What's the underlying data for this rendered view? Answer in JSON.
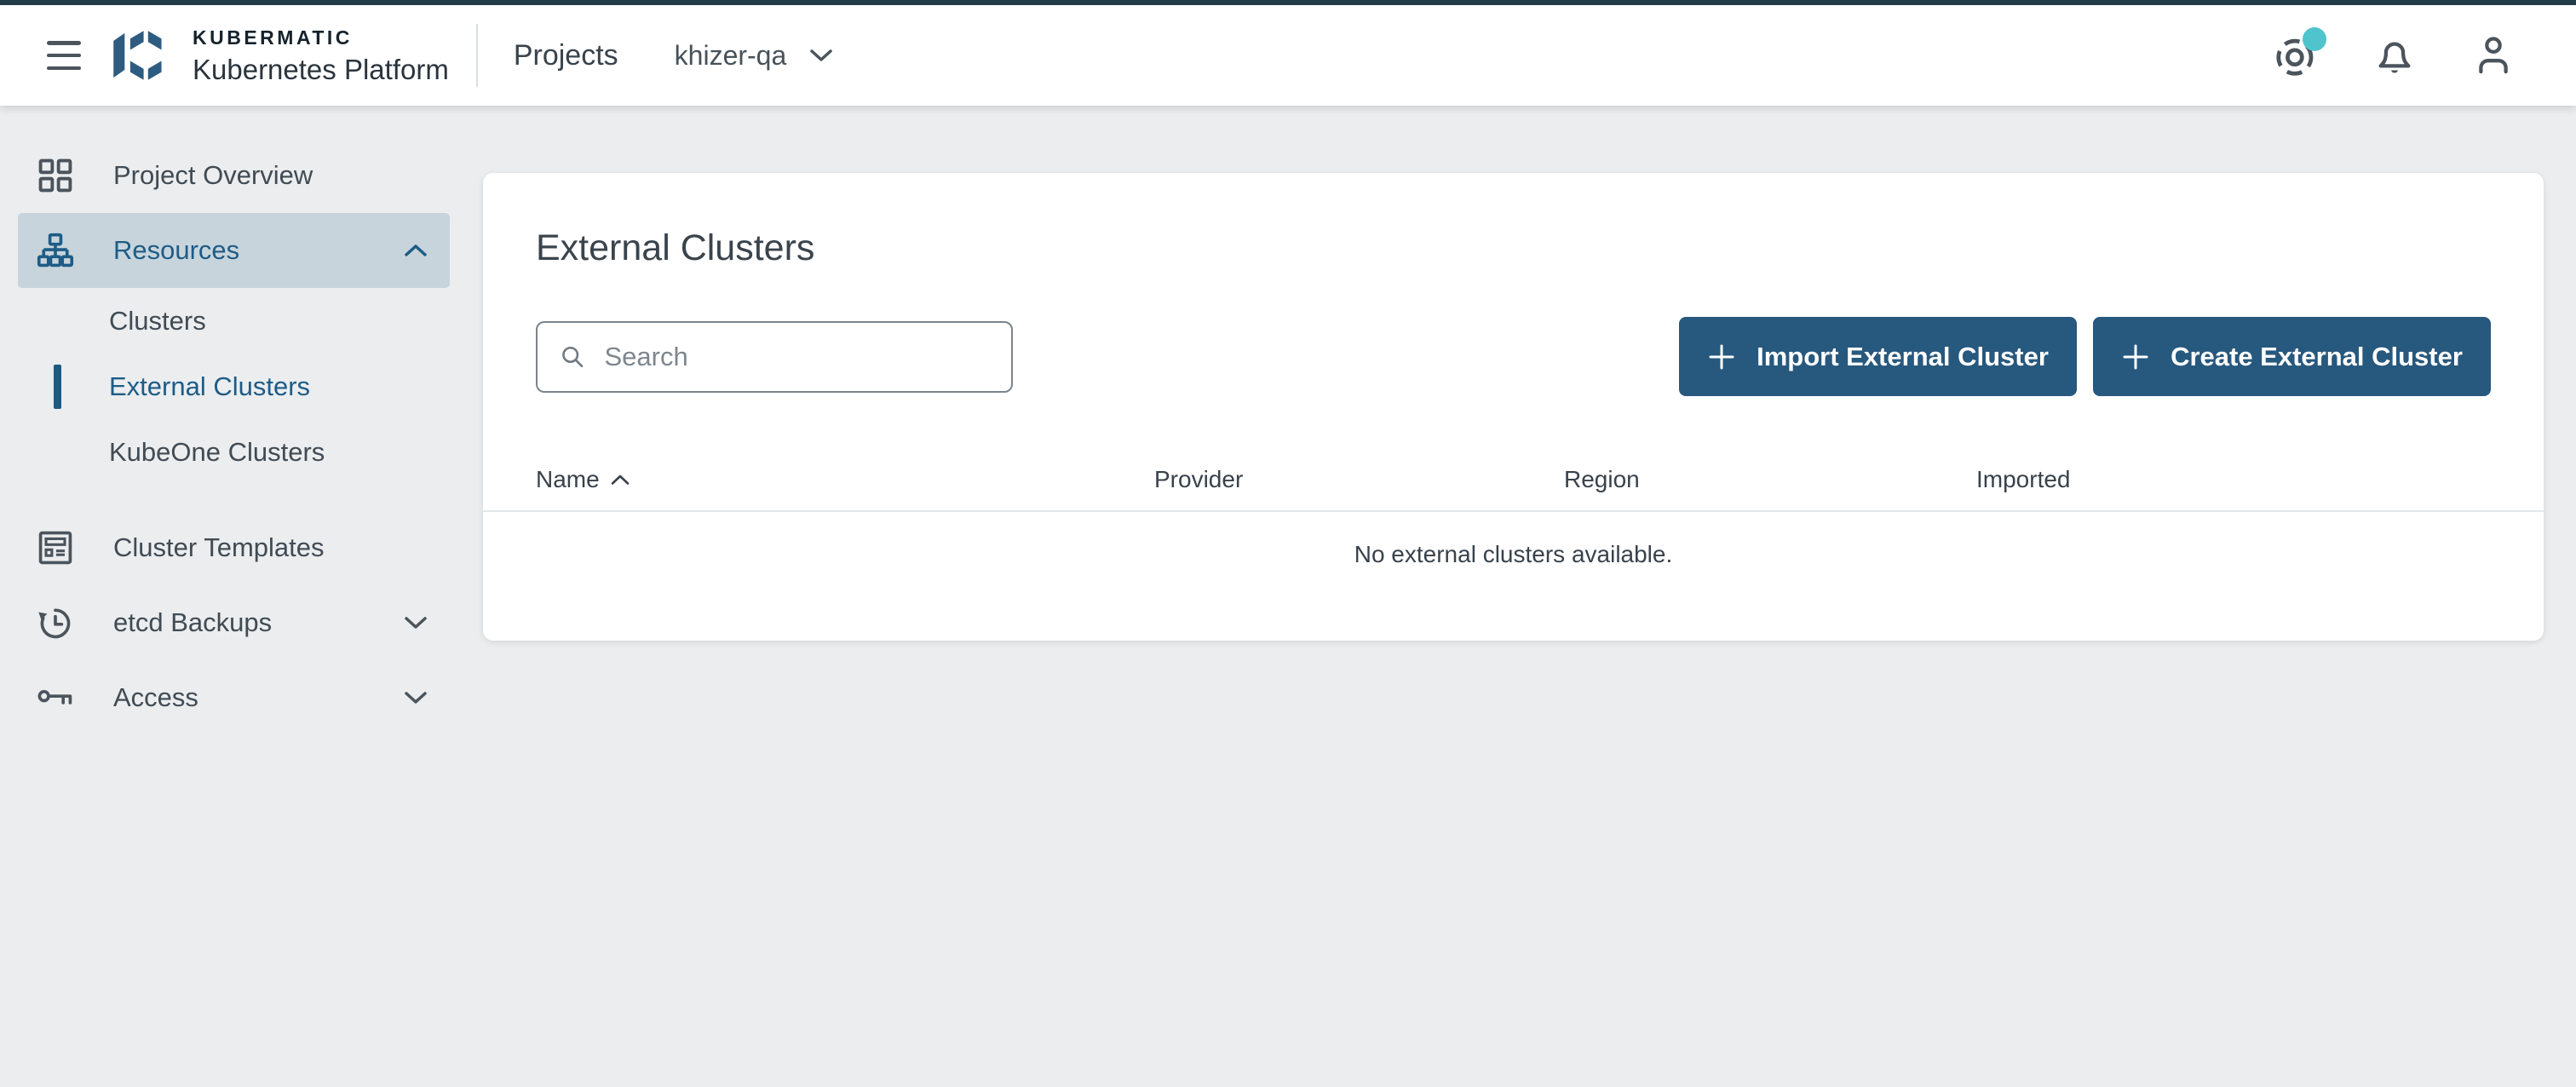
{
  "header": {
    "brand": {
      "title": "KUBERMATIC",
      "subtitle": "Kubernetes Platform"
    },
    "projects_label": "Projects",
    "project_selector": {
      "value": "khizer-qa"
    }
  },
  "sidebar": {
    "items": [
      {
        "label": "Project Overview"
      },
      {
        "label": "Resources",
        "expanded": true
      },
      {
        "label": "Clusters"
      },
      {
        "label": "External Clusters",
        "active": true
      },
      {
        "label": "KubeOne Clusters"
      },
      {
        "label": "Cluster Templates"
      },
      {
        "label": "etcd Backups",
        "expanded": false
      },
      {
        "label": "Access",
        "expanded": false
      }
    ]
  },
  "main": {
    "title": "External Clusters",
    "search": {
      "placeholder": "Search",
      "value": ""
    },
    "actions": {
      "import_label": "Import External Cluster",
      "create_label": "Create External Cluster"
    },
    "table": {
      "columns": [
        "Name",
        "Provider",
        "Region",
        "Imported"
      ],
      "sort": {
        "column": "Name",
        "direction": "asc"
      },
      "empty_message": "No external clusters available."
    }
  },
  "icons": {
    "menu": "hamburger",
    "help": "lifebuoy-ring",
    "notifications": "bell",
    "user": "person",
    "project_overview": "grid",
    "resources": "sitemap",
    "cluster_templates": "template-document",
    "etcd_backups": "history-clock",
    "access": "key",
    "search": "magnifier",
    "add": "plus",
    "sort_asc": "chevron-up",
    "collapse": "chevron-up",
    "expand": "chevron-down"
  },
  "colors": {
    "brand_blue": "#2e5c80",
    "accent_blue": "#1d5c87",
    "button_blue": "#27587e",
    "badge_teal": "#4fc4cc",
    "header_border": "#233c49",
    "sidebar_highlight": "#c8d4db",
    "background": "#ebedef"
  }
}
